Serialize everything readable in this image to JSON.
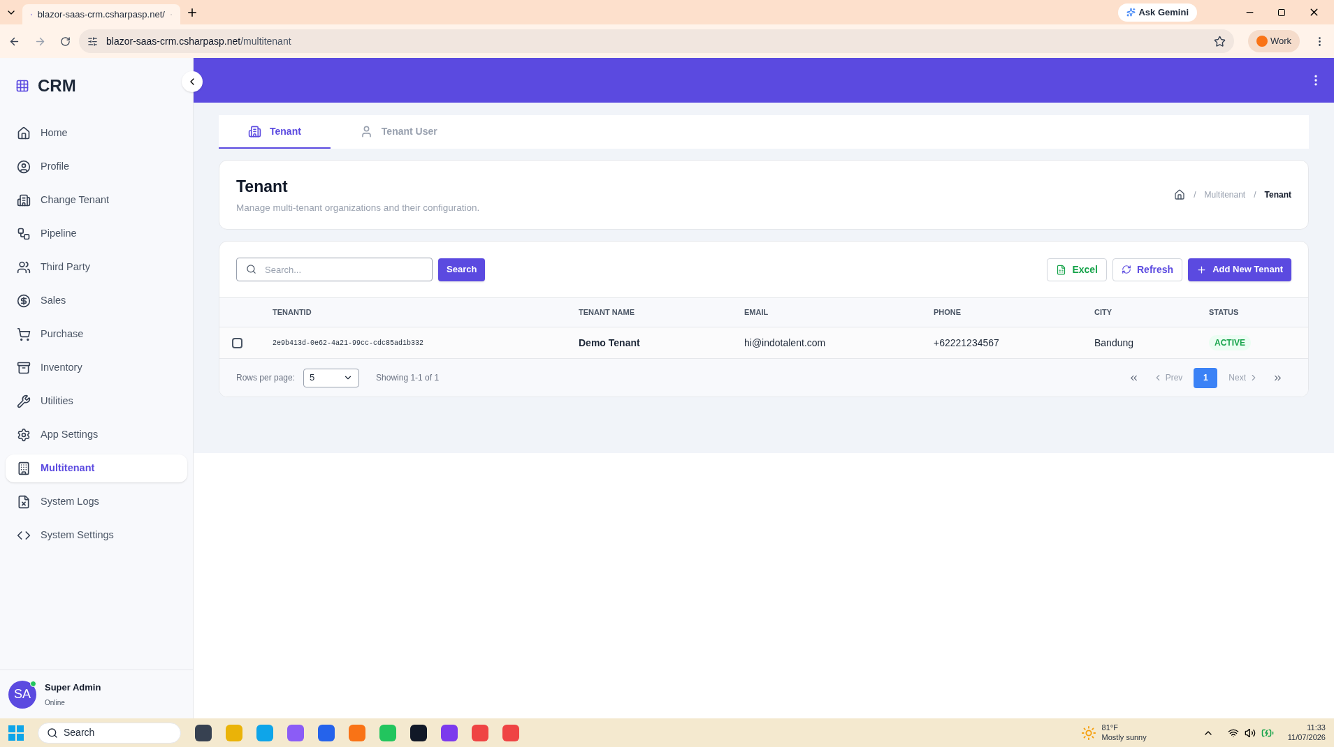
{
  "browser": {
    "tab_title": "blazor-saas-crm.csharpasp.net/",
    "url_host": "blazor-saas-crm.csharpasp.net",
    "url_path": "/multitenant",
    "gemini": "Ask Gemini",
    "profile": "Work"
  },
  "sidebar": {
    "brand": "CRM",
    "items": [
      {
        "label": "Home",
        "selected": false
      },
      {
        "label": "Profile",
        "selected": false
      },
      {
        "label": "Change Tenant",
        "selected": false
      },
      {
        "label": "Pipeline",
        "selected": false
      },
      {
        "label": "Third Party",
        "selected": false
      },
      {
        "label": "Sales",
        "selected": false
      },
      {
        "label": "Purchase",
        "selected": false
      },
      {
        "label": "Inventory",
        "selected": false
      },
      {
        "label": "Utilities",
        "selected": false
      },
      {
        "label": "App Settings",
        "selected": false
      },
      {
        "label": "Multitenant",
        "selected": true
      },
      {
        "label": "System Logs",
        "selected": false
      },
      {
        "label": "System Settings",
        "selected": false
      }
    ],
    "user": {
      "initials": "SA",
      "name": "Super Admin",
      "status": "Online",
      "online": true
    }
  },
  "tabs": [
    {
      "label": "Tenant",
      "selected": true
    },
    {
      "label": "Tenant User",
      "selected": false
    }
  ],
  "page_header": {
    "title": "Tenant",
    "subtitle": "Manage multi-tenant organizations and their configuration.",
    "breadcrumb": [
      "Multitenant",
      "Tenant"
    ],
    "breadcrumb_separator": "/"
  },
  "toolbar": {
    "search_placeholder": "Search...",
    "search_button": "Search",
    "buttons": [
      {
        "kind": "excel",
        "label": "Excel"
      },
      {
        "kind": "refresh",
        "label": "Refresh"
      },
      {
        "kind": "add",
        "label": "Add New Tenant"
      }
    ]
  },
  "table": {
    "columns": [
      "TENANTID",
      "TENANT NAME",
      "EMAIL",
      "PHONE",
      "CITY",
      "STATUS"
    ],
    "rows": [
      {
        "checked": false,
        "tenant_id": "2e9b413d-0e62-4a21-99cc-cdc85ad1b332",
        "name": "Demo Tenant",
        "email": "hi@indotalent.com",
        "phone": "+62221234567",
        "city": "Bandung",
        "status": "ACTIVE"
      }
    ]
  },
  "pagination": {
    "rows_label": "Rows per page:",
    "rows_value": "5",
    "showing": "Showing 1-1 of 1",
    "prev": "Prev",
    "next": "Next",
    "pages": [
      {
        "label": "1",
        "selected": true
      }
    ]
  },
  "taskbar": {
    "search": "Search",
    "temperature": "81°F",
    "weather": "Mostly sunny",
    "time": "11:33",
    "date": "11/07/2026"
  }
}
